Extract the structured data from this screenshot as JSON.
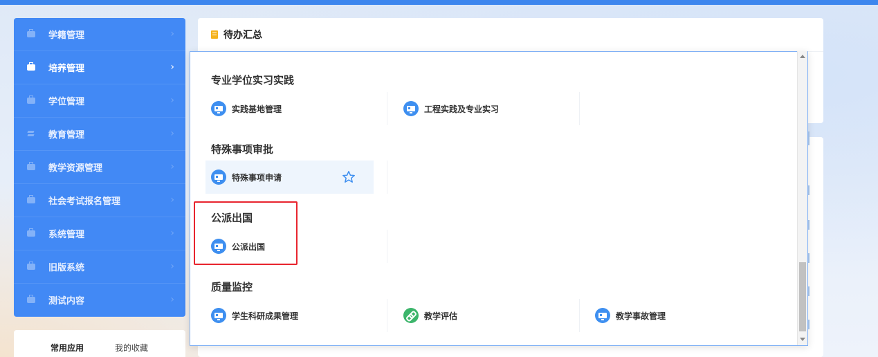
{
  "sidebar": {
    "items": [
      {
        "label": "学籍管理",
        "icon": "briefcase-icon",
        "active": false
      },
      {
        "label": "培养管理",
        "icon": "briefcase-icon",
        "active": true
      },
      {
        "label": "学位管理",
        "icon": "briefcase-icon",
        "active": false
      },
      {
        "label": "教育管理",
        "icon": "layers-icon",
        "active": false
      },
      {
        "label": "教学资源管理",
        "icon": "briefcase-icon",
        "active": false
      },
      {
        "label": "社会考试报名管理",
        "icon": "briefcase-icon",
        "active": false
      },
      {
        "label": "系统管理",
        "icon": "briefcase-icon",
        "active": false
      },
      {
        "label": "旧版系统",
        "icon": "briefcase-icon",
        "active": false
      },
      {
        "label": "测试内容",
        "icon": "briefcase-icon",
        "active": false
      }
    ],
    "chevron": "›"
  },
  "quick_tabs": {
    "common": "常用应用",
    "favorites": "我的收藏"
  },
  "todo": {
    "title": "待办汇总"
  },
  "menu": {
    "sections": [
      {
        "title": "专业学位实习实践",
        "items": [
          "实践基地管理",
          "工程实践及专业实习"
        ]
      },
      {
        "title": "特殊事项审批",
        "items": [
          "特殊事项申请"
        ]
      },
      {
        "title": "公派出国",
        "items": [
          "公派出国"
        ]
      },
      {
        "title": "质量监控",
        "items": [
          "学生科研成果管理",
          "教学评估",
          "教学事故管理"
        ]
      }
    ]
  },
  "colors": {
    "accent": "#4289f5",
    "highlight_box": "#e8242e",
    "icon_blue": "#3e8ff0",
    "icon_green": "#3cb56b"
  }
}
